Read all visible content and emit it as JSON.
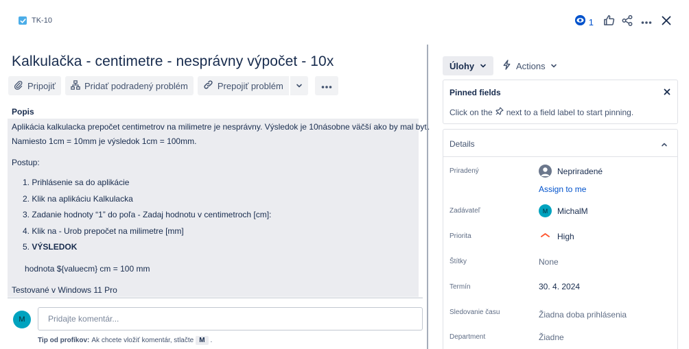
{
  "header": {
    "issue_key": "TK-10",
    "watch_count": "1",
    "icons": [
      "checkbox-icon",
      "eye-icon",
      "thumbs-up-icon",
      "share-icon",
      "more-icon",
      "close-icon"
    ]
  },
  "issue": {
    "title": "Kalkulačka - centimetre - nesprávny výpočet - 10x"
  },
  "toolbar": {
    "attach_label": "Pripojiť",
    "subtask_label": "Pridať podradený problém",
    "link_label": "Prepojiť problém"
  },
  "description": {
    "label": "Popis",
    "line1": "Aplikácia kalkulacka prepočet centimetrov na milimetre je nesprávny. Výsledok je 10násobne väčší ako by mal byť.",
    "line2": "Namiesto 1cm = 10mm je výsledok 1cm = 100mm.",
    "line3": "Postup:",
    "steps": [
      "1. Prihlásenie sa do aplikácie",
      "2. Klik na aplikáciu Kalkulacka",
      "3. Zadanie hodnoty “1” do poľa - Zadaj hodnotu v centimetroch [cm]:",
      "4. Klik na - Urob prepočet na milimetre [mm]"
    ],
    "step5_number": "5.",
    "step5_label": "VÝSLEDOK",
    "result": "hodnota ${valuecm} cm = 100 mm",
    "environment": "Testované v Windows 11 Pro"
  },
  "comment": {
    "avatar_initial": "M",
    "placeholder": "Pridajte komentár...",
    "tip_label": "Tip od profíkov:",
    "tip_text": "Ak chcete vložiť komentár, stlačte",
    "tip_key": "M",
    "tip_end": "."
  },
  "side": {
    "status_label": "Úlohy",
    "actions_label": "Actions",
    "pinned": {
      "title": "Pinned fields",
      "text_before": "Click on the",
      "text_after": "next to a field label to start pinning."
    },
    "details": {
      "title": "Details",
      "fields": {
        "assignee_label": "Priradený",
        "assignee_value": "Nepriradené",
        "assign_to_me": "Assign to me",
        "reporter_label": "Zadávateľ",
        "reporter_initial": "M",
        "reporter_value": "MichalM",
        "priority_label": "Priorita",
        "priority_value": "High",
        "labels_label": "Štítky",
        "labels_value": "None",
        "due_label": "Termín",
        "due_value": "30. 4. 2024",
        "time_label": "Sledovanie času",
        "time_value": "Žiadna doba prihlásenia",
        "department_label": "Department",
        "department_value": "Žiadne"
      }
    }
  },
  "colors": {
    "accent": "#0052cc",
    "avatar": "#00a3bf",
    "priority_high": "#ff5630",
    "description_bg": "#ebecf0"
  }
}
